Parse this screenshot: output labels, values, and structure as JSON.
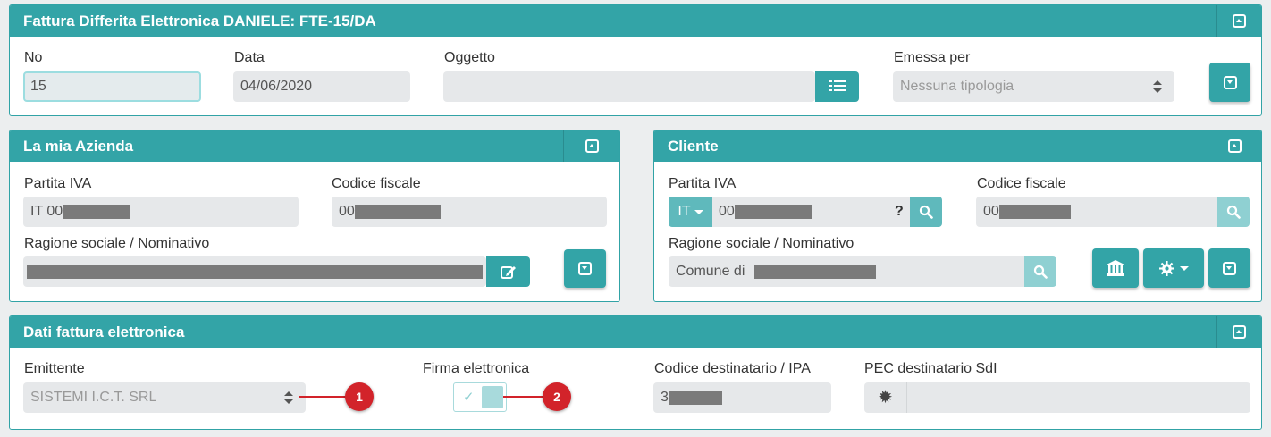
{
  "header_panel": {
    "title": "Fattura Differita Elettronica DANIELE: FTE-15/DA",
    "no_label": "No",
    "no_value": "15",
    "data_label": "Data",
    "data_value": "04/06/2020",
    "oggetto_label": "Oggetto",
    "oggetto_value": "",
    "emessa_label": "Emessa per",
    "emessa_value": "Nessuna tipologia"
  },
  "azienda_panel": {
    "title": "La mia Azienda",
    "piva_label": "Partita IVA",
    "piva_value": "IT 00",
    "cf_label": "Codice fiscale",
    "cf_value": "00",
    "ragione_label": "Ragione sociale / Nominativo"
  },
  "cliente_panel": {
    "title": "Cliente",
    "piva_label": "Partita IVA",
    "country_code": "IT",
    "piva_value": "00",
    "help_glyph": "?",
    "cf_label": "Codice fiscale",
    "cf_value": "00",
    "ragione_label": "Ragione sociale / Nominativo",
    "ragione_value": "Comune di"
  },
  "fattura_panel": {
    "title": "Dati fattura elettronica",
    "emittente_label": "Emittente",
    "emittente_value": "SISTEMI I.C.T. SRL",
    "firma_label": "Firma elettronica",
    "firma_check": "✓",
    "codice_label": "Codice destinatario / IPA",
    "codice_value": "3",
    "pec_label": "PEC destinatario SdI"
  },
  "markers": [
    "1",
    "2"
  ],
  "icons": [
    "collapse-up-icon",
    "collapse-down-icon",
    "list-icon",
    "edit-icon",
    "search-icon",
    "bank-icon",
    "gear-icon",
    "caret-down-icon",
    "asterisk-icon"
  ],
  "colors": {
    "accent": "#33a4a7",
    "marker": "#d2232a"
  }
}
